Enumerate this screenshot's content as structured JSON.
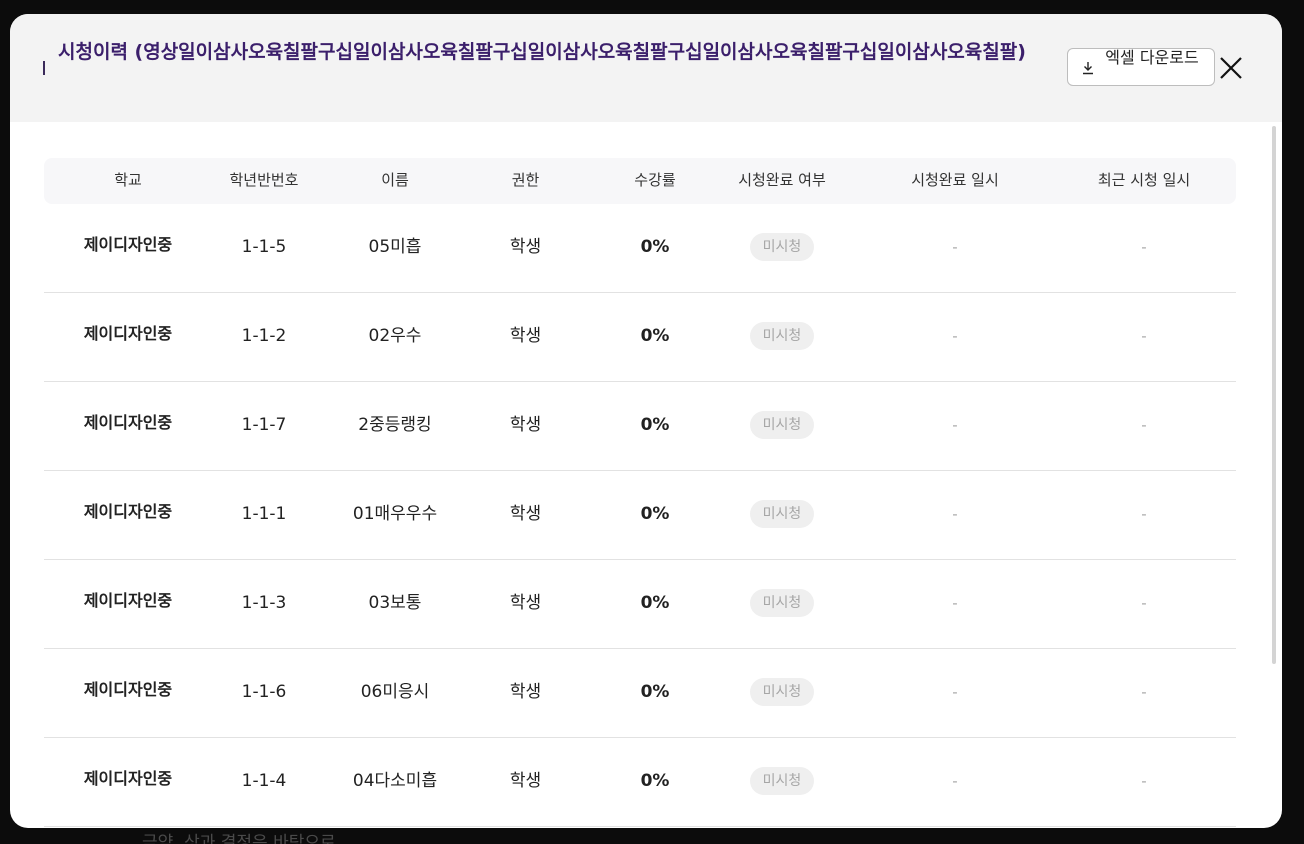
{
  "backdrop": {
    "text": "극약, 상과 결정은 바탕으로 ..."
  },
  "modal": {
    "title": "시청이력 (영상일이삼사오육칠팔구십일이삼사오육칠팔구십일이삼사오육칠팔구십일이삼사오육칠팔구십일이삼사오육칠팔)",
    "excel_button_label": "엑셀 다운로드",
    "download_icon": "download-icon",
    "close_icon": "close-icon"
  },
  "table": {
    "headers": [
      "학교",
      "학년반번호",
      "이름",
      "권한",
      "수강률",
      "시청완료 여부",
      "시청완료 일시",
      "최근 시청 일시"
    ],
    "rows": [
      {
        "school": "제이디자인중",
        "class_no": "1-1-5",
        "name": "05미흡",
        "role": "학생",
        "rate": "0%",
        "status": "미시청",
        "completed_at": "-",
        "last_viewed_at": "-"
      },
      {
        "school": "제이디자인중",
        "class_no": "1-1-2",
        "name": "02우수",
        "role": "학생",
        "rate": "0%",
        "status": "미시청",
        "completed_at": "-",
        "last_viewed_at": "-"
      },
      {
        "school": "제이디자인중",
        "class_no": "1-1-7",
        "name": "2중등랭킹",
        "role": "학생",
        "rate": "0%",
        "status": "미시청",
        "completed_at": "-",
        "last_viewed_at": "-"
      },
      {
        "school": "제이디자인중",
        "class_no": "1-1-1",
        "name": "01매우우수",
        "role": "학생",
        "rate": "0%",
        "status": "미시청",
        "completed_at": "-",
        "last_viewed_at": "-"
      },
      {
        "school": "제이디자인중",
        "class_no": "1-1-3",
        "name": "03보통",
        "role": "학생",
        "rate": "0%",
        "status": "미시청",
        "completed_at": "-",
        "last_viewed_at": "-"
      },
      {
        "school": "제이디자인중",
        "class_no": "1-1-6",
        "name": "06미응시",
        "role": "학생",
        "rate": "0%",
        "status": "미시청",
        "completed_at": "-",
        "last_viewed_at": "-"
      },
      {
        "school": "제이디자인중",
        "class_no": "1-1-4",
        "name": "04다소미흡",
        "role": "학생",
        "rate": "0%",
        "status": "미시청",
        "completed_at": "-",
        "last_viewed_at": "-"
      }
    ]
  },
  "colors": {
    "title": "#3b1f6b",
    "header_bg": "#f3f3f3",
    "badge_bg": "#efefef",
    "badge_text": "#a6a6a6"
  }
}
